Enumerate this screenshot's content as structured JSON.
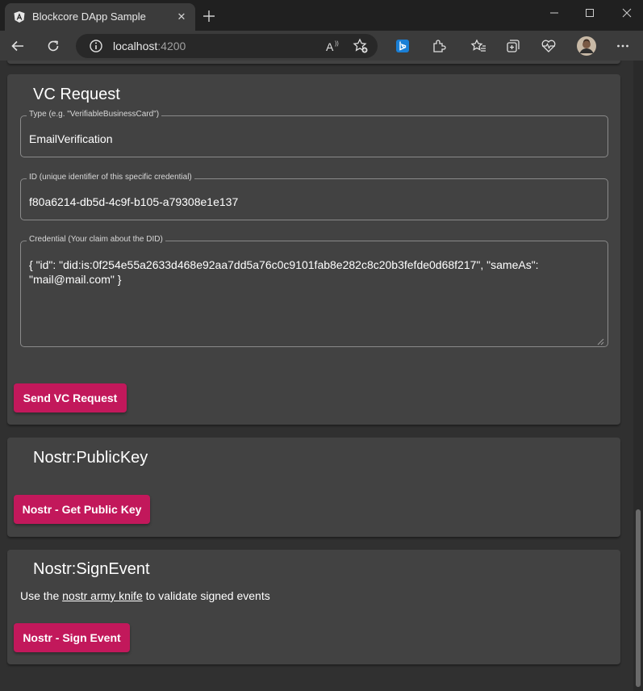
{
  "browser": {
    "tab_title": "Blockcore DApp Sample",
    "url_host": "localhost",
    "url_port": ":4200"
  },
  "vc_request": {
    "title": "VC Request",
    "type_label": "Type (e.g. \"VerifiableBusinessCard\")",
    "type_value": "EmailVerification",
    "id_label": "ID (unique identifier of this specific credential)",
    "id_value": "f80a6214-db5d-4c9f-b105-a79308e1e137",
    "credential_label": "Credential (Your claim about the DID)",
    "credential_value": "{ \"id\": \"did:is:0f254e55a2633d468e92aa7dd5a76c0c9101fab8e282c8c20b3fefde0d68f217\", \"sameAs\": \"mail@mail.com\" }",
    "button": "Send VC Request"
  },
  "nostr_public_key": {
    "title": "Nostr:PublicKey",
    "button": "Nostr - Get Public Key"
  },
  "nostr_sign_event": {
    "title": "Nostr:SignEvent",
    "desc_prefix": "Use the ",
    "desc_link": "nostr army knife",
    "desc_suffix": " to validate signed events",
    "button": "Nostr - Sign Event"
  },
  "colors": {
    "accent": "#c2185b",
    "card_bg": "#424242",
    "page_bg": "#303030"
  },
  "icons": [
    "angular-logo-icon",
    "close-icon",
    "plus-icon",
    "minimize-icon",
    "maximize-icon",
    "window-close-icon",
    "back-icon",
    "refresh-icon",
    "info-icon",
    "read-aloud-icon",
    "add-favorite-icon",
    "bing-icon",
    "extensions-icon",
    "favorites-icon",
    "collections-icon",
    "browser-essentials-icon",
    "profile-avatar",
    "more-icon"
  ]
}
